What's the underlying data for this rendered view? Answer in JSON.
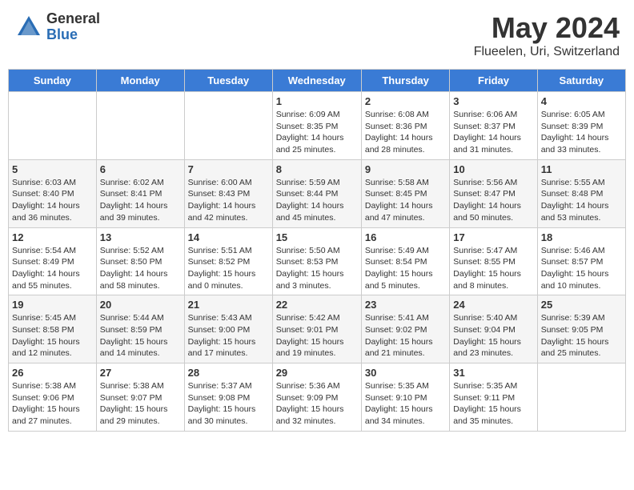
{
  "header": {
    "logo_general": "General",
    "logo_blue": "Blue",
    "month_title": "May 2024",
    "location": "Flueelen, Uri, Switzerland"
  },
  "days_of_week": [
    "Sunday",
    "Monday",
    "Tuesday",
    "Wednesday",
    "Thursday",
    "Friday",
    "Saturday"
  ],
  "weeks": [
    [
      {
        "day": "",
        "info": ""
      },
      {
        "day": "",
        "info": ""
      },
      {
        "day": "",
        "info": ""
      },
      {
        "day": "1",
        "info": "Sunrise: 6:09 AM\nSunset: 8:35 PM\nDaylight: 14 hours and 25 minutes."
      },
      {
        "day": "2",
        "info": "Sunrise: 6:08 AM\nSunset: 8:36 PM\nDaylight: 14 hours and 28 minutes."
      },
      {
        "day": "3",
        "info": "Sunrise: 6:06 AM\nSunset: 8:37 PM\nDaylight: 14 hours and 31 minutes."
      },
      {
        "day": "4",
        "info": "Sunrise: 6:05 AM\nSunset: 8:39 PM\nDaylight: 14 hours and 33 minutes."
      }
    ],
    [
      {
        "day": "5",
        "info": "Sunrise: 6:03 AM\nSunset: 8:40 PM\nDaylight: 14 hours and 36 minutes."
      },
      {
        "day": "6",
        "info": "Sunrise: 6:02 AM\nSunset: 8:41 PM\nDaylight: 14 hours and 39 minutes."
      },
      {
        "day": "7",
        "info": "Sunrise: 6:00 AM\nSunset: 8:43 PM\nDaylight: 14 hours and 42 minutes."
      },
      {
        "day": "8",
        "info": "Sunrise: 5:59 AM\nSunset: 8:44 PM\nDaylight: 14 hours and 45 minutes."
      },
      {
        "day": "9",
        "info": "Sunrise: 5:58 AM\nSunset: 8:45 PM\nDaylight: 14 hours and 47 minutes."
      },
      {
        "day": "10",
        "info": "Sunrise: 5:56 AM\nSunset: 8:47 PM\nDaylight: 14 hours and 50 minutes."
      },
      {
        "day": "11",
        "info": "Sunrise: 5:55 AM\nSunset: 8:48 PM\nDaylight: 14 hours and 53 minutes."
      }
    ],
    [
      {
        "day": "12",
        "info": "Sunrise: 5:54 AM\nSunset: 8:49 PM\nDaylight: 14 hours and 55 minutes."
      },
      {
        "day": "13",
        "info": "Sunrise: 5:52 AM\nSunset: 8:50 PM\nDaylight: 14 hours and 58 minutes."
      },
      {
        "day": "14",
        "info": "Sunrise: 5:51 AM\nSunset: 8:52 PM\nDaylight: 15 hours and 0 minutes."
      },
      {
        "day": "15",
        "info": "Sunrise: 5:50 AM\nSunset: 8:53 PM\nDaylight: 15 hours and 3 minutes."
      },
      {
        "day": "16",
        "info": "Sunrise: 5:49 AM\nSunset: 8:54 PM\nDaylight: 15 hours and 5 minutes."
      },
      {
        "day": "17",
        "info": "Sunrise: 5:47 AM\nSunset: 8:55 PM\nDaylight: 15 hours and 8 minutes."
      },
      {
        "day": "18",
        "info": "Sunrise: 5:46 AM\nSunset: 8:57 PM\nDaylight: 15 hours and 10 minutes."
      }
    ],
    [
      {
        "day": "19",
        "info": "Sunrise: 5:45 AM\nSunset: 8:58 PM\nDaylight: 15 hours and 12 minutes."
      },
      {
        "day": "20",
        "info": "Sunrise: 5:44 AM\nSunset: 8:59 PM\nDaylight: 15 hours and 14 minutes."
      },
      {
        "day": "21",
        "info": "Sunrise: 5:43 AM\nSunset: 9:00 PM\nDaylight: 15 hours and 17 minutes."
      },
      {
        "day": "22",
        "info": "Sunrise: 5:42 AM\nSunset: 9:01 PM\nDaylight: 15 hours and 19 minutes."
      },
      {
        "day": "23",
        "info": "Sunrise: 5:41 AM\nSunset: 9:02 PM\nDaylight: 15 hours and 21 minutes."
      },
      {
        "day": "24",
        "info": "Sunrise: 5:40 AM\nSunset: 9:04 PM\nDaylight: 15 hours and 23 minutes."
      },
      {
        "day": "25",
        "info": "Sunrise: 5:39 AM\nSunset: 9:05 PM\nDaylight: 15 hours and 25 minutes."
      }
    ],
    [
      {
        "day": "26",
        "info": "Sunrise: 5:38 AM\nSunset: 9:06 PM\nDaylight: 15 hours and 27 minutes."
      },
      {
        "day": "27",
        "info": "Sunrise: 5:38 AM\nSunset: 9:07 PM\nDaylight: 15 hours and 29 minutes."
      },
      {
        "day": "28",
        "info": "Sunrise: 5:37 AM\nSunset: 9:08 PM\nDaylight: 15 hours and 30 minutes."
      },
      {
        "day": "29",
        "info": "Sunrise: 5:36 AM\nSunset: 9:09 PM\nDaylight: 15 hours and 32 minutes."
      },
      {
        "day": "30",
        "info": "Sunrise: 5:35 AM\nSunset: 9:10 PM\nDaylight: 15 hours and 34 minutes."
      },
      {
        "day": "31",
        "info": "Sunrise: 5:35 AM\nSunset: 9:11 PM\nDaylight: 15 hours and 35 minutes."
      },
      {
        "day": "",
        "info": ""
      }
    ]
  ]
}
